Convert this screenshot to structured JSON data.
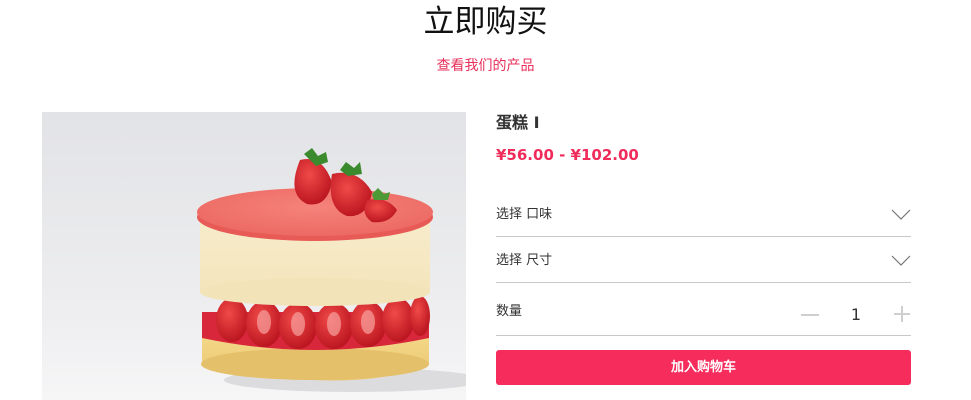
{
  "header": {
    "title": "立即购买",
    "subtitle": "查看我们的产品"
  },
  "product": {
    "image_alt": "strawberry-mousse-cake-photo",
    "name": "蛋糕 I",
    "price": "¥56.00 - ¥102.00",
    "options": [
      {
        "label": "选择 口味",
        "icon": "chevron-down-icon"
      },
      {
        "label": "选择 尺寸",
        "icon": "chevron-down-icon"
      }
    ],
    "quantity": {
      "label": "数量",
      "value": "1",
      "minus_icon": "minus-icon",
      "plus_icon": "plus-icon"
    },
    "add_to_cart_label": "加入购物车"
  },
  "colors": {
    "accent": "#f52c5c",
    "price": "#f02c5b",
    "subtitle": "#e8305b",
    "divider": "#c8c8c8"
  }
}
